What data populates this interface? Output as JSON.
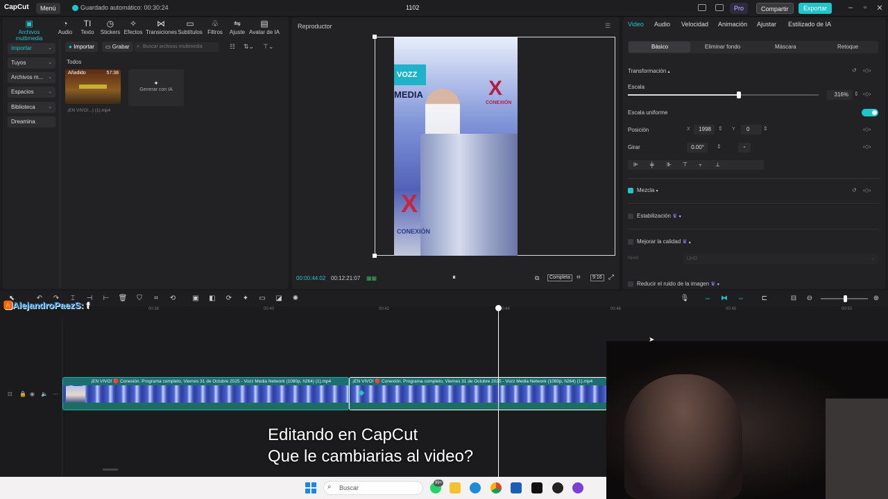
{
  "titlebar": {
    "logo": "CapCut",
    "menu": "Menú",
    "autosave": "Guardado automático: 00:30:24",
    "project_title": "1102",
    "pro": "Pro",
    "share": "Compartir",
    "export": "Exportar"
  },
  "toolbar": [
    {
      "label": "Archivos multimedia",
      "icon": "media-icon"
    },
    {
      "label": "Audio",
      "icon": "audio-icon"
    },
    {
      "label": "Texto",
      "icon": "text-icon"
    },
    {
      "label": "Stickers",
      "icon": "sticker-icon"
    },
    {
      "label": "Efectos",
      "icon": "effects-icon"
    },
    {
      "label": "Transiciones",
      "icon": "transitions-icon"
    },
    {
      "label": "Subtítulos",
      "icon": "subtitles-icon"
    },
    {
      "label": "Filtros",
      "icon": "filters-icon"
    },
    {
      "label": "Ajuste",
      "icon": "adjust-icon"
    },
    {
      "label": "Avatar de IA",
      "icon": "ai-avatar-icon"
    }
  ],
  "sidebar": [
    "Importar",
    "Tuyos",
    "Archivos m...",
    "Espacios",
    "Biblioteca",
    "Dreamina"
  ],
  "media": {
    "import": "Importar",
    "record": "Grabar",
    "search_placeholder": "Buscar archivos multimedia",
    "all": "Todos",
    "added": "Añadido",
    "duration": "57:38",
    "filename": "¡EN VIVO!...) (1).mp4",
    "generate_ai": "Generar con IA"
  },
  "player": {
    "title": "Reproductor",
    "current": "00:00:44:02",
    "total": "00:12:21:07",
    "full": "Completa",
    "ratio": "9:16"
  },
  "props": {
    "tabs": [
      "Video",
      "Audio",
      "Velocidad",
      "Animación",
      "Ajustar",
      "Estilizado de IA"
    ],
    "subtabs": [
      "Básico",
      "Eliminar fondo",
      "Máscara",
      "Retoque"
    ],
    "transform": "Transformación",
    "scale": "Escala",
    "scale_value": "316%",
    "uniform_scale": "Escala uniforme",
    "position": "Posición",
    "x_label": "X",
    "x_value": "1998",
    "y_label": "Y",
    "y_value": "0",
    "rotate": "Girar",
    "rotate_value": "0.00°",
    "blend": "Mezcla",
    "stabilize": "Estabilización",
    "enhance": "Mejorar la calidad",
    "level": "Nivel",
    "level_value": "UHD",
    "denoise": "Reducir el ruido de la imagen",
    "scale_fraction": 0.58
  },
  "timeline": {
    "ticks": [
      "00:38",
      "00:40",
      "00:42",
      "00:44",
      "00:46",
      "00:48",
      "00:50"
    ],
    "clip1_title": "¡EN VIVO! 🔴 Conexión. Programa completo, Viernes 31 de Octubre 2025 - Vozz Media Network (1080p, h264) (1).mp4",
    "clip2_title": "¡EN VIVO! 🔴 Conexión. Programa completo, Viernes 31 de Octubre 2025 - Vozz Media Network (1080p, h264) (1).mp4"
  },
  "overlay": {
    "watermark": "AlejandroPaezS:",
    "caption_line1": "Editando en CapCut",
    "caption_line2": "Que le cambiarias al video?"
  },
  "taskbar": {
    "search": "Buscar",
    "badge": "99+"
  },
  "video_frame": {
    "brand_top": "VOZZ",
    "brand_media": "MEDIA",
    "brand_conexion": "CONEXIÓN"
  }
}
